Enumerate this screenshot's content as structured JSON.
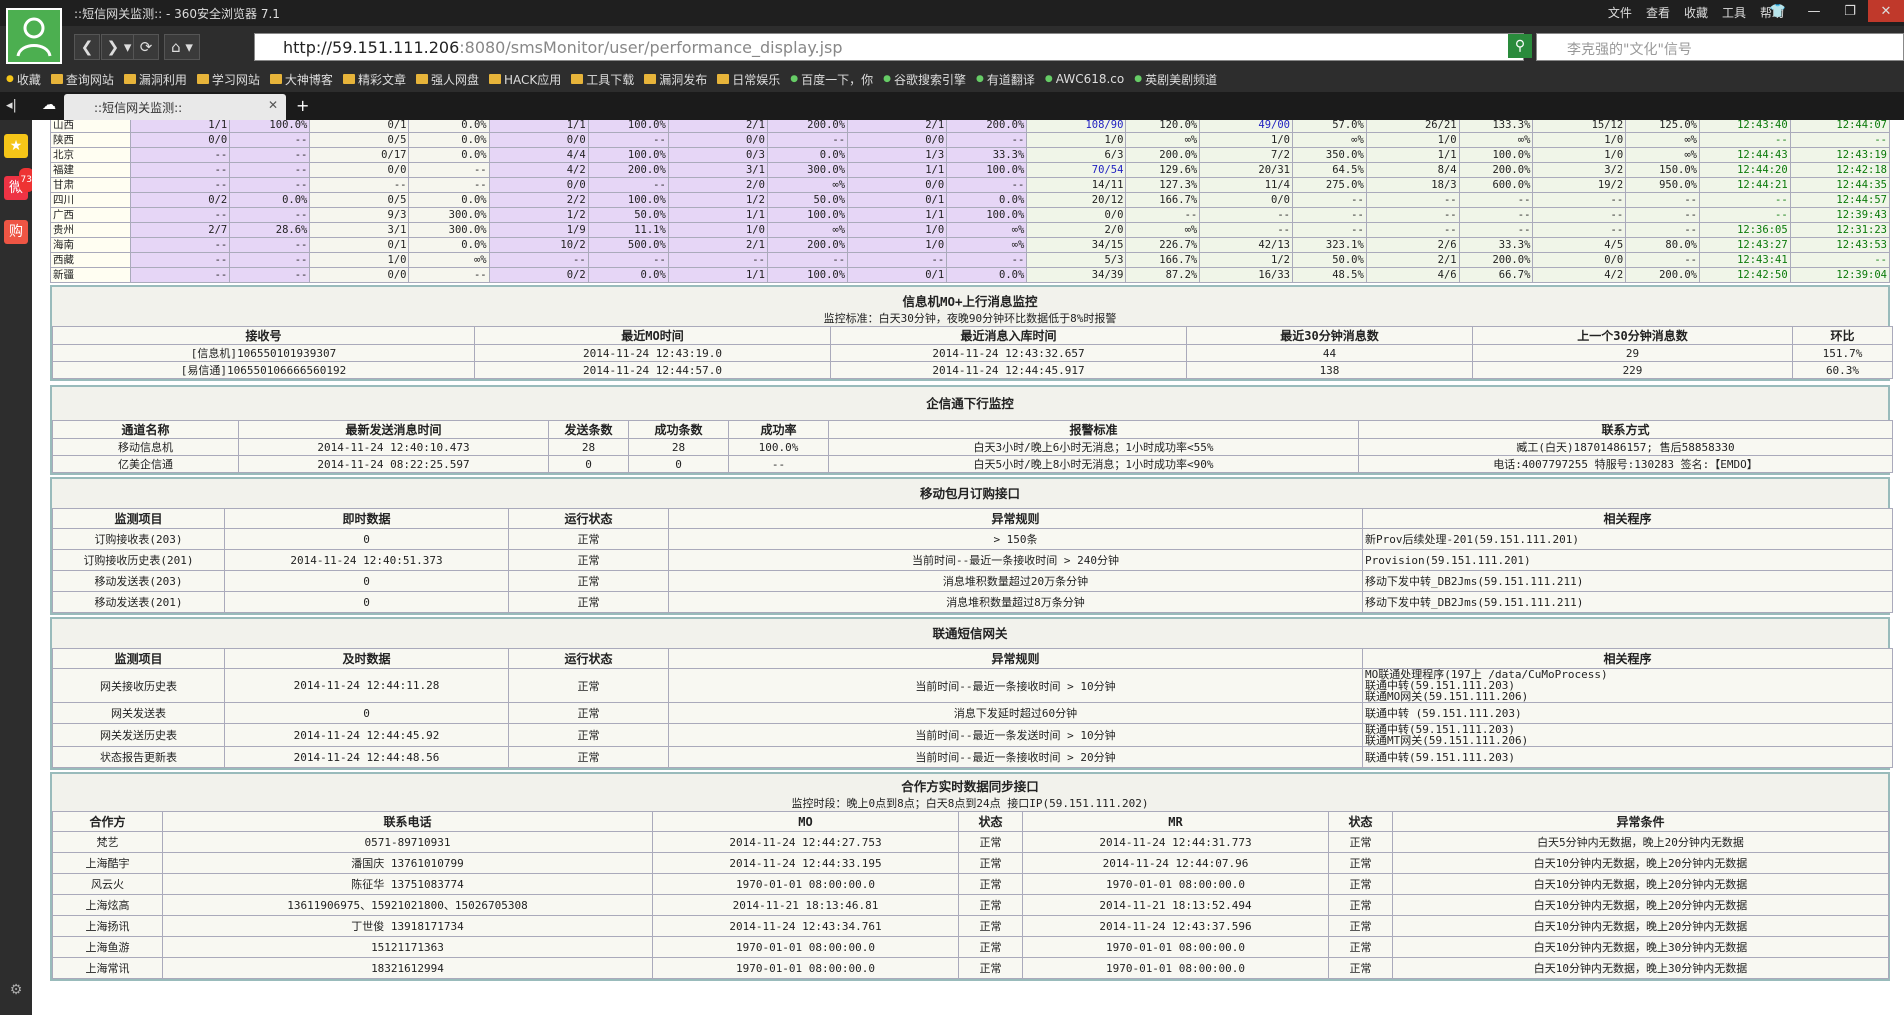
{
  "window": {
    "title": "::短信网关监测:: - 360安全浏览器 7.1",
    "menu": [
      "文件",
      "查看",
      "收藏",
      "工具",
      "帮助"
    ]
  },
  "nav": {
    "url_host": "http://59.151.111.206",
    "url_path": ":8080/smsMonitor/user/performance_display.jsp",
    "search_placeholder": "李克强的\"文化\"信号"
  },
  "bookmarks": [
    {
      "label": "收藏",
      "icon": "star-icon"
    },
    {
      "label": "查询网站",
      "icon": "folder-icon"
    },
    {
      "label": "漏洞利用",
      "icon": "folder-icon"
    },
    {
      "label": "学习网站",
      "icon": "folder-icon"
    },
    {
      "label": "大神博客",
      "icon": "folder-icon"
    },
    {
      "label": "精彩文章",
      "icon": "folder-icon"
    },
    {
      "label": "强人网盘",
      "icon": "folder-icon"
    },
    {
      "label": "HACK应用",
      "icon": "folder-icon"
    },
    {
      "label": "工具下载",
      "icon": "folder-icon"
    },
    {
      "label": "漏洞发布",
      "icon": "folder-icon"
    },
    {
      "label": "日常娱乐",
      "icon": "folder-icon"
    },
    {
      "label": "百度一下，你",
      "icon": "baidu-icon"
    },
    {
      "label": "谷歌搜索引擎",
      "icon": "google-icon"
    },
    {
      "label": "有道翻译",
      "icon": "youdao-icon"
    },
    {
      "label": "AWC618.co",
      "icon": "web-icon"
    },
    {
      "label": "英剧美剧频道",
      "icon": "video-icon"
    }
  ],
  "tab": {
    "label": "::短信网关监测::"
  },
  "sidebar_badge": "73",
  "provinces": [
    {
      "name": "山西",
      "c": [
        "1/1",
        "100.0%",
        "0/1",
        "0.0%",
        "1/1",
        "100.0%",
        "2/1",
        "200.0%",
        "2/1",
        "200.0%",
        "108/90",
        "120.0%",
        "49/00",
        "57.0%",
        "26/21",
        "133.3%",
        "15/12",
        "125.0%",
        "12:43:40",
        "12:44:07"
      ]
    },
    {
      "name": "陕西",
      "c": [
        "0/0",
        "--",
        "0/5",
        "0.0%",
        "0/0",
        "--",
        "0/0",
        "--",
        "0/0",
        "--",
        "1/0",
        "∞%",
        "1/0",
        "∞%",
        "1/0",
        "∞%",
        "1/0",
        "∞%",
        "--",
        "--"
      ]
    },
    {
      "name": "北京",
      "c": [
        "--",
        "--",
        "0/17",
        "0.0%",
        "4/4",
        "100.0%",
        "0/3",
        "0.0%",
        "1/3",
        "33.3%",
        "6/3",
        "200.0%",
        "7/2",
        "350.0%",
        "1/1",
        "100.0%",
        "1/0",
        "∞%",
        "12:44:43",
        "12:43:19"
      ]
    },
    {
      "name": "福建",
      "c": [
        "--",
        "--",
        "0/0",
        "--",
        "4/2",
        "200.0%",
        "3/1",
        "300.0%",
        "1/1",
        "100.0%",
        "70/54",
        "129.6%",
        "20/31",
        "64.5%",
        "8/4",
        "200.0%",
        "3/2",
        "150.0%",
        "12:44:20",
        "12:42:18"
      ]
    },
    {
      "name": "甘肃",
      "c": [
        "--",
        "--",
        "--",
        "--",
        "0/0",
        "--",
        "2/0",
        "∞%",
        "0/0",
        "--",
        "14/11",
        "127.3%",
        "11/4",
        "275.0%",
        "18/3",
        "600.0%",
        "19/2",
        "950.0%",
        "12:44:21",
        "12:44:35"
      ]
    },
    {
      "name": "四川",
      "c": [
        "0/2",
        "0.0%",
        "0/5",
        "0.0%",
        "2/2",
        "100.0%",
        "1/2",
        "50.0%",
        "0/1",
        "0.0%",
        "20/12",
        "166.7%",
        "0/0",
        "--",
        "--",
        "--",
        "--",
        "--",
        "--",
        "12:44:57"
      ]
    },
    {
      "name": "广西",
      "c": [
        "--",
        "--",
        "9/3",
        "300.0%",
        "1/2",
        "50.0%",
        "1/1",
        "100.0%",
        "1/1",
        "100.0%",
        "0/0",
        "--",
        "--",
        "--",
        "--",
        "--",
        "--",
        "--",
        "--",
        "12:39:43"
      ]
    },
    {
      "name": "贵州",
      "c": [
        "2/7",
        "28.6%",
        "3/1",
        "300.0%",
        "1/9",
        "11.1%",
        "1/0",
        "∞%",
        "1/0",
        "∞%",
        "2/0",
        "∞%",
        "--",
        "--",
        "--",
        "--",
        "--",
        "--",
        "12:36:05",
        "12:31:23"
      ]
    },
    {
      "name": "海南",
      "c": [
        "--",
        "--",
        "0/1",
        "0.0%",
        "10/2",
        "500.0%",
        "2/1",
        "200.0%",
        "1/0",
        "∞%",
        "34/15",
        "226.7%",
        "42/13",
        "323.1%",
        "2/6",
        "33.3%",
        "4/5",
        "80.0%",
        "12:43:27",
        "12:43:53"
      ]
    },
    {
      "name": "西藏",
      "c": [
        "--",
        "--",
        "1/0",
        "∞%",
        "--",
        "--",
        "--",
        "--",
        "--",
        "--",
        "5/3",
        "166.7%",
        "1/2",
        "50.0%",
        "2/1",
        "200.0%",
        "0/0",
        "--",
        "12:43:41",
        "--"
      ]
    },
    {
      "name": "新疆",
      "c": [
        "--",
        "--",
        "0/0",
        "--",
        "0/2",
        "0.0%",
        "1/1",
        "100.0%",
        "0/1",
        "0.0%",
        "34/39",
        "87.2%",
        "16/33",
        "48.5%",
        "4/6",
        "66.7%",
        "4/2",
        "200.0%",
        "12:42:50",
        "12:39:04"
      ]
    }
  ],
  "mo": {
    "title": "信息机MO+上行消息监控",
    "subtitle": "监控标准：白天30分钟，夜晚90分钟环比数据低于8%时报警",
    "headers": [
      "接收号",
      "最近MO时间",
      "最近消息入库时间",
      "最近30分钟消息数",
      "上一个30分钟消息数",
      "环比"
    ],
    "rows": [
      [
        "[信息机]106550101939307",
        "2014-11-24 12:43:19.0",
        "2014-11-24 12:43:32.657",
        "44",
        "29",
        "151.7%"
      ],
      [
        "[易信通]106550106666560192",
        "2014-11-24 12:44:57.0",
        "2014-11-24 12:44:45.917",
        "138",
        "229",
        "60.3%"
      ]
    ]
  },
  "qxt": {
    "title": "企信通下行监控",
    "headers": [
      "通道名称",
      "最新发送消息时间",
      "发送条数",
      "成功条数",
      "成功率",
      "报警标准",
      "联系方式"
    ],
    "rows": [
      [
        "移动信息机",
        "2014-11-24 12:40:10.473",
        "28",
        "28",
        "100.0%",
        "白天3小时/晚上6小时无消息；1小时成功率<55%",
        "臧工(白天)18701486157; 售后58858330"
      ],
      [
        "亿美企信通",
        "2014-11-24 08:22:25.597",
        "0",
        "0",
        "--",
        "白天5小时/晚上8小时无消息；1小时成功率<90%",
        "电话:4007797255 特服号:130283 签名:【EMDO】"
      ]
    ]
  },
  "yd": {
    "title": "移动包月订购接口",
    "headers": [
      "监测项目",
      "即时数据",
      "运行状态",
      "异常规则",
      "相关程序"
    ],
    "rows": [
      [
        "订购接收表(203)",
        "0",
        "正常",
        "> 150条",
        "新Prov后续处理-201(59.151.111.201)"
      ],
      [
        "订购接收历史表(201)",
        "2014-11-24 12:40:51.373",
        "正常",
        "当前时间--最近一条接收时间 > 240分钟",
        "Provision(59.151.111.201)"
      ],
      [
        "移动发送表(203)",
        "0",
        "正常",
        "消息堆积数量超过20万条分钟",
        "移动下发中转_DB2Jms(59.151.111.211)"
      ],
      [
        "移动发送表(201)",
        "0",
        "正常",
        "消息堆积数量超过8万条分钟",
        "移动下发中转_DB2Jms(59.151.111.211)"
      ]
    ]
  },
  "lt": {
    "title": "联通短信网关",
    "headers": [
      "监测项目",
      "及时数据",
      "运行状态",
      "异常规则",
      "相关程序"
    ],
    "rows": [
      [
        "网关接收历史表",
        "2014-11-24 12:44:11.28",
        "正常",
        "当前时间--最近一条接收时间 > 10分钟",
        "MO联通处理程序(197上 /data/CuMoProcess)|联通中转(59.151.111.203)|联通MO网关(59.151.111.206)"
      ],
      [
        "网关发送表",
        "0",
        "正常",
        "消息下发延时超过60分钟",
        "联通中转 (59.151.111.203)"
      ],
      [
        "网关发送历史表",
        "2014-11-24 12:44:45.92",
        "正常",
        "当前时间--最近一条发送时间 > 10分钟",
        "联通中转(59.151.111.203)|联通MT网关(59.151.111.206)"
      ],
      [
        "状态报告更新表",
        "2014-11-24 12:44:48.56",
        "正常",
        "当前时间--最近一条接收时间 > 20分钟",
        "联通中转(59.151.111.203)"
      ]
    ]
  },
  "hz": {
    "title": "合作方实时数据同步接口",
    "subtitle": "监控时段：晚上0点到8点；白天8点到24点 接口IP(59.151.111.202)",
    "headers": [
      "合作方",
      "联系电话",
      "MO",
      "状态",
      "MR",
      "状态",
      "异常条件"
    ],
    "rows": [
      [
        "梵艺",
        "0571-89710931",
        "2014-11-24 12:44:27.753",
        "正常",
        "2014-11-24 12:44:31.773",
        "正常",
        "白天5分钟内无数据，晚上20分钟内无数据"
      ],
      [
        "上海酷宇",
        "潘国庆 13761010799",
        "2014-11-24 12:44:33.195",
        "正常",
        "2014-11-24 12:44:07.96",
        "正常",
        "白天10分钟内无数据，晚上20分钟内无数据"
      ],
      [
        "风云火",
        "陈征华 13751083774",
        "1970-01-01 08:00:00.0",
        "正常",
        "1970-01-01 08:00:00.0",
        "正常",
        "白天10分钟内无数据，晚上20分钟内无数据"
      ],
      [
        "上海炫高",
        "13611906975、15921021800、15026705308",
        "2014-11-21 18:13:46.81",
        "正常",
        "2014-11-21 18:13:52.494",
        "正常",
        "白天10分钟内无数据，晚上20分钟内无数据"
      ],
      [
        "上海扬讯",
        "丁世俊 13918171734",
        "2014-11-24 12:43:34.761",
        "正常",
        "2014-11-24 12:43:37.596",
        "正常",
        "白天10分钟内无数据，晚上20分钟内无数据"
      ],
      [
        "上海鱼游",
        "15121171363",
        "1970-01-01 08:00:00.0",
        "正常",
        "1970-01-01 08:00:00.0",
        "正常",
        "白天10分钟内无数据，晚上30分钟内无数据"
      ],
      [
        "上海常讯",
        "18321612994",
        "1970-01-01 08:00:00.0",
        "正常",
        "1970-01-01 08:00:00.0",
        "正常",
        "白天10分钟内无数据，晚上30分钟内无数据"
      ]
    ]
  }
}
